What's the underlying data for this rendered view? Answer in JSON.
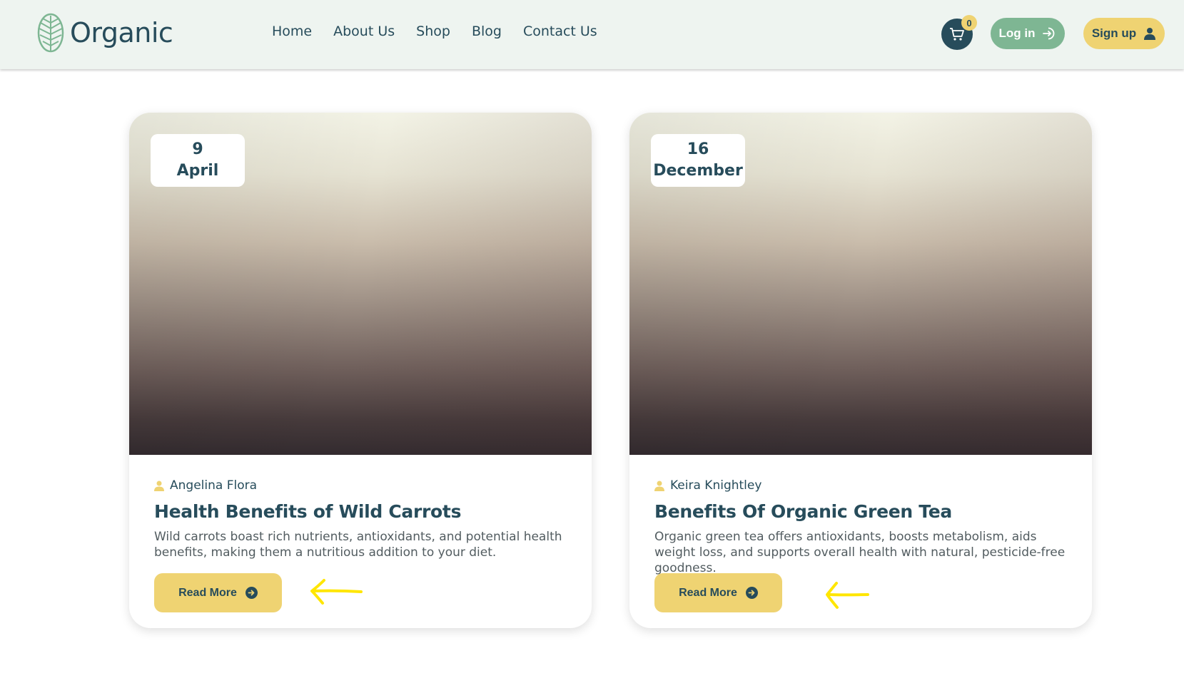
{
  "brand": {
    "name": "Organic"
  },
  "nav": {
    "items": [
      {
        "label": "Home"
      },
      {
        "label": "About Us"
      },
      {
        "label": "Shop"
      },
      {
        "label": "Blog"
      },
      {
        "label": "Contact Us"
      }
    ]
  },
  "header": {
    "cart_count": "0",
    "login_label": "Log in",
    "signup_label": "Sign up"
  },
  "colors": {
    "primary": "#274c5b",
    "accent_yellow": "#efd372",
    "accent_green": "#7eb693",
    "header_bg": "#eef4f0",
    "annotation_arrow": "#ffe600"
  },
  "posts": [
    {
      "day": "9",
      "month": "April",
      "author": "Angelina Flora",
      "title": "Health Benefits of Wild Carrots",
      "excerpt": "Wild carrots boast rich nutrients, antioxidants, and potential health benefits, making them a nutritious addition to your diet.",
      "button_label": "Read More"
    },
    {
      "day": "16",
      "month": "December",
      "author": "Keira Knightley",
      "title": "Benefits Of Organic Green Tea",
      "excerpt": "Organic green tea offers antioxidants, boosts metabolism, aids weight loss, and supports overall health with natural, pesticide-free goodness.",
      "button_label": "Read More"
    }
  ]
}
